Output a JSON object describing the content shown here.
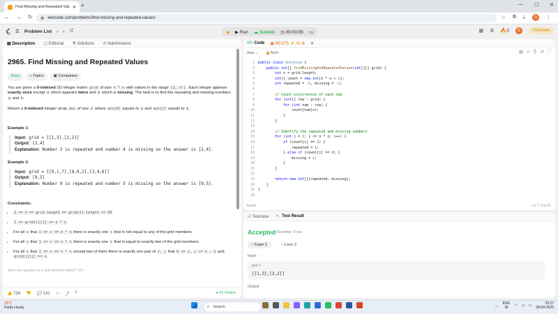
{
  "browser": {
    "tab_title": "Find Missing and Repeated Valu",
    "new_tab": "+",
    "url": "leetcode.com/problems/find-missing-and-repeated-values/",
    "avatar": "G"
  },
  "topbar": {
    "problem_list": "Problem List",
    "run": "Run",
    "submit": "Submit",
    "timer": "00:00:05",
    "fire_count": "0",
    "avatar": "G",
    "premium": "Premium"
  },
  "left_tabs": [
    "Description",
    "Editorial",
    "Solutions",
    "Submissions"
  ],
  "problem": {
    "title": "2965. Find Missing and Repeated Values",
    "difficulty": "Easy",
    "topics": "Topics",
    "companies": "Companies",
    "desc1_a": "You are given a ",
    "desc1_b": "0-indexed",
    "desc1_c": " 2D integer matrix ",
    "grid": "grid",
    "desc1_d": " of size ",
    "nxn": "n * n",
    "desc1_e": " with values in the range ",
    "range": "[1, n²]",
    "desc1_f": ". Each integer appears ",
    "exactly_once": "exactly once",
    "desc1_g": " except ",
    "a": "a",
    "desc1_h": " which appears ",
    "twice": "twice",
    "desc1_i": " and ",
    "b": "b",
    "desc1_j": " which is ",
    "missing": "missing",
    "desc1_k": ". The task is to find the repeating and missing numbers ",
    "desc1_l": " and ",
    "desc1_m": ".",
    "desc2_a": "Return a ",
    "desc2_b": "0-indexed",
    "desc2_c": " integer array ",
    "ans": "ans",
    "desc2_d": " of size ",
    "two": "2",
    "desc2_e": " where ",
    "ans0": "ans[0]",
    "desc2_f": " equals to ",
    "desc2_g": " and ",
    "ans1": "ans[1]",
    "desc2_h": " equals to ",
    "desc2_i": ".",
    "ex1_title": "Example 1:",
    "ex1_in": "grid = [[1,3],[2,2]]",
    "ex1_out": "[2,4]",
    "ex1_exp": "Number 2 is repeated and number 4 is missing so the answer is [2,4].",
    "ex2_title": "Example 2:",
    "ex2_in": "grid = [[9,1,7],[8,9,2],[3,4,6]]",
    "ex2_out": "[9,5]",
    "ex2_exp": "Number 9 is repeated and number 5 is missing so the answer is [9,5].",
    "input_lbl": "Input:",
    "output_lbl": "Output:",
    "expl_lbl": "Explanation:",
    "constraints": "Constraints:",
    "c1": "2 <= n == grid.length == grid[i].length <= 50",
    "c2": "1 <= grid[i][j] <= n * n",
    "c3_a": "For all ",
    "x": "x",
    "c3_b": " that ",
    "c3_code": "1 <= x <= n * n",
    "c3_c": " there is exactly one ",
    "c3_d": " that is not equal to any of the grid members.",
    "c4_d": " that is equal to exactly two of the grid members.",
    "c5_c": " except two of them there is exactly one pair of ",
    "ij": "i, j",
    "c5_e": " that ",
    "c5_code": "0 <= i, j <= n - 1",
    "c5_f": " and ",
    "c5_code2": "grid[i][j] == x",
    "c5_g": ".",
    "cut": "Seen this question in a real interview before?   1/5",
    "likes": "734",
    "comments": "141",
    "online": "41 Online"
  },
  "code_tabs": {
    "code": "Code",
    "beats": "BEATS",
    "lang": "Java",
    "auto": "Auto"
  },
  "code_lines": [
    "public class Solution {",
    "    public int[] findMissingAndRepeatedValues(int[][] grid) {",
    "        int n = grid.length;",
    "        int[] count = new int[n * n + 1];",
    "        int repeated = -1, missing = -1;",
    "",
    "        // Count occurrences of each num",
    "        for (int[] row : grid) {",
    "            for (int num : row) {",
    "                count[num]++;",
    "            }",
    "        }",
    "",
    "        // Identify the repeated and missing numbers",
    "        for (int i = 1; i <= n * n; i++) {",
    "            if (count[i] == 2) {",
    "                repeated = i;",
    "            } else if (count[i] == 0) {",
    "                missing = i;",
    "            }",
    "        }",
    "",
    "        return new int[]{repeated, missing};",
    "    }",
    "}",
    ""
  ],
  "editor_status": {
    "saved": "Saved",
    "position": "Ln 7, Col 41"
  },
  "test": {
    "tab_testcase": "Testcase",
    "tab_result": "Test Result",
    "status": "Accepted",
    "runtime": "Runtime: 0 ms",
    "case1": "Case 1",
    "case2": "Case 2",
    "input": "Input",
    "var": "grid =",
    "value": "[[1,3],[2,2]]",
    "output": "Output"
  },
  "taskbar": {
    "temp": "28°C",
    "weather": "Partly cloudy",
    "search": "Search",
    "lang1": "ENG",
    "lang2": "IN",
    "time": "23:27",
    "date": "08-04-2025"
  }
}
